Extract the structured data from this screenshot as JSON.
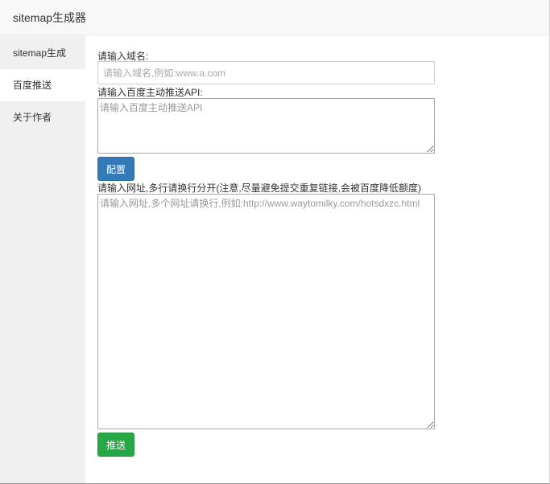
{
  "window": {
    "title": "sitemap生成器"
  },
  "sidebar": {
    "items": [
      {
        "label": "sitemap生成",
        "active": false
      },
      {
        "label": "百度推送",
        "active": true
      },
      {
        "label": "关于作者",
        "active": false
      }
    ]
  },
  "form": {
    "domain": {
      "label": "请输入域名:",
      "placeholder": "请输入域名,例如:www.a.com",
      "value": ""
    },
    "api": {
      "label": "请输入百度主动推送API:",
      "placeholder": "请输入百度主动推送API",
      "value": ""
    },
    "config_button": "配置",
    "urls": {
      "label": "请输入网址,多行请换行分开(注意,尽量避免提交重复链接,会被百度降低额度)",
      "placeholder": "请输入网址,多个网址请换行,例如:http://www.waytomilky.com/hotsdxzc.html",
      "value": ""
    },
    "push_button": "推送"
  },
  "colors": {
    "config_button": "#337ab7",
    "push_button": "#28a745",
    "sidebar_bg": "#f0f0f0",
    "titlebar_bg": "#f8f8f8"
  }
}
